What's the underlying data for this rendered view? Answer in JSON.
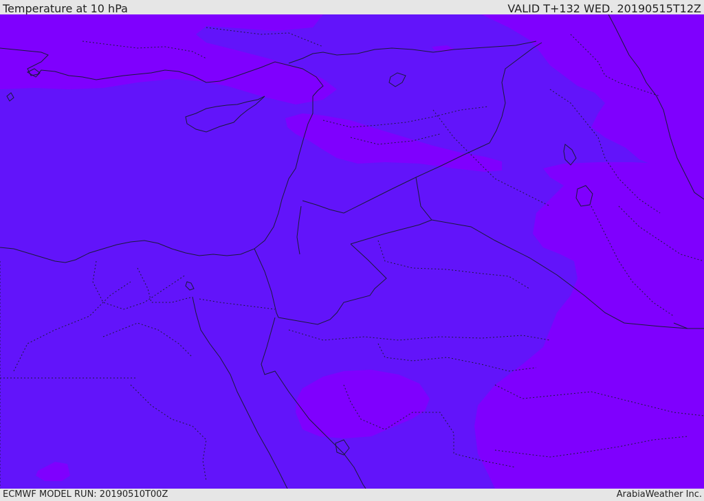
{
  "header": {
    "title": "Temperature at 10 hPa",
    "valid": "VALID T+132 WED. 20190515T12Z"
  },
  "footer": {
    "model_run": "ECMWF MODEL RUN: 20190510T00Z",
    "credit": "ArabiaWeather Inc."
  },
  "map": {
    "colors": {
      "background_field": "#6214fa",
      "warmer_patches": "#7f00fe",
      "borders": "#1a1a3a"
    }
  }
}
